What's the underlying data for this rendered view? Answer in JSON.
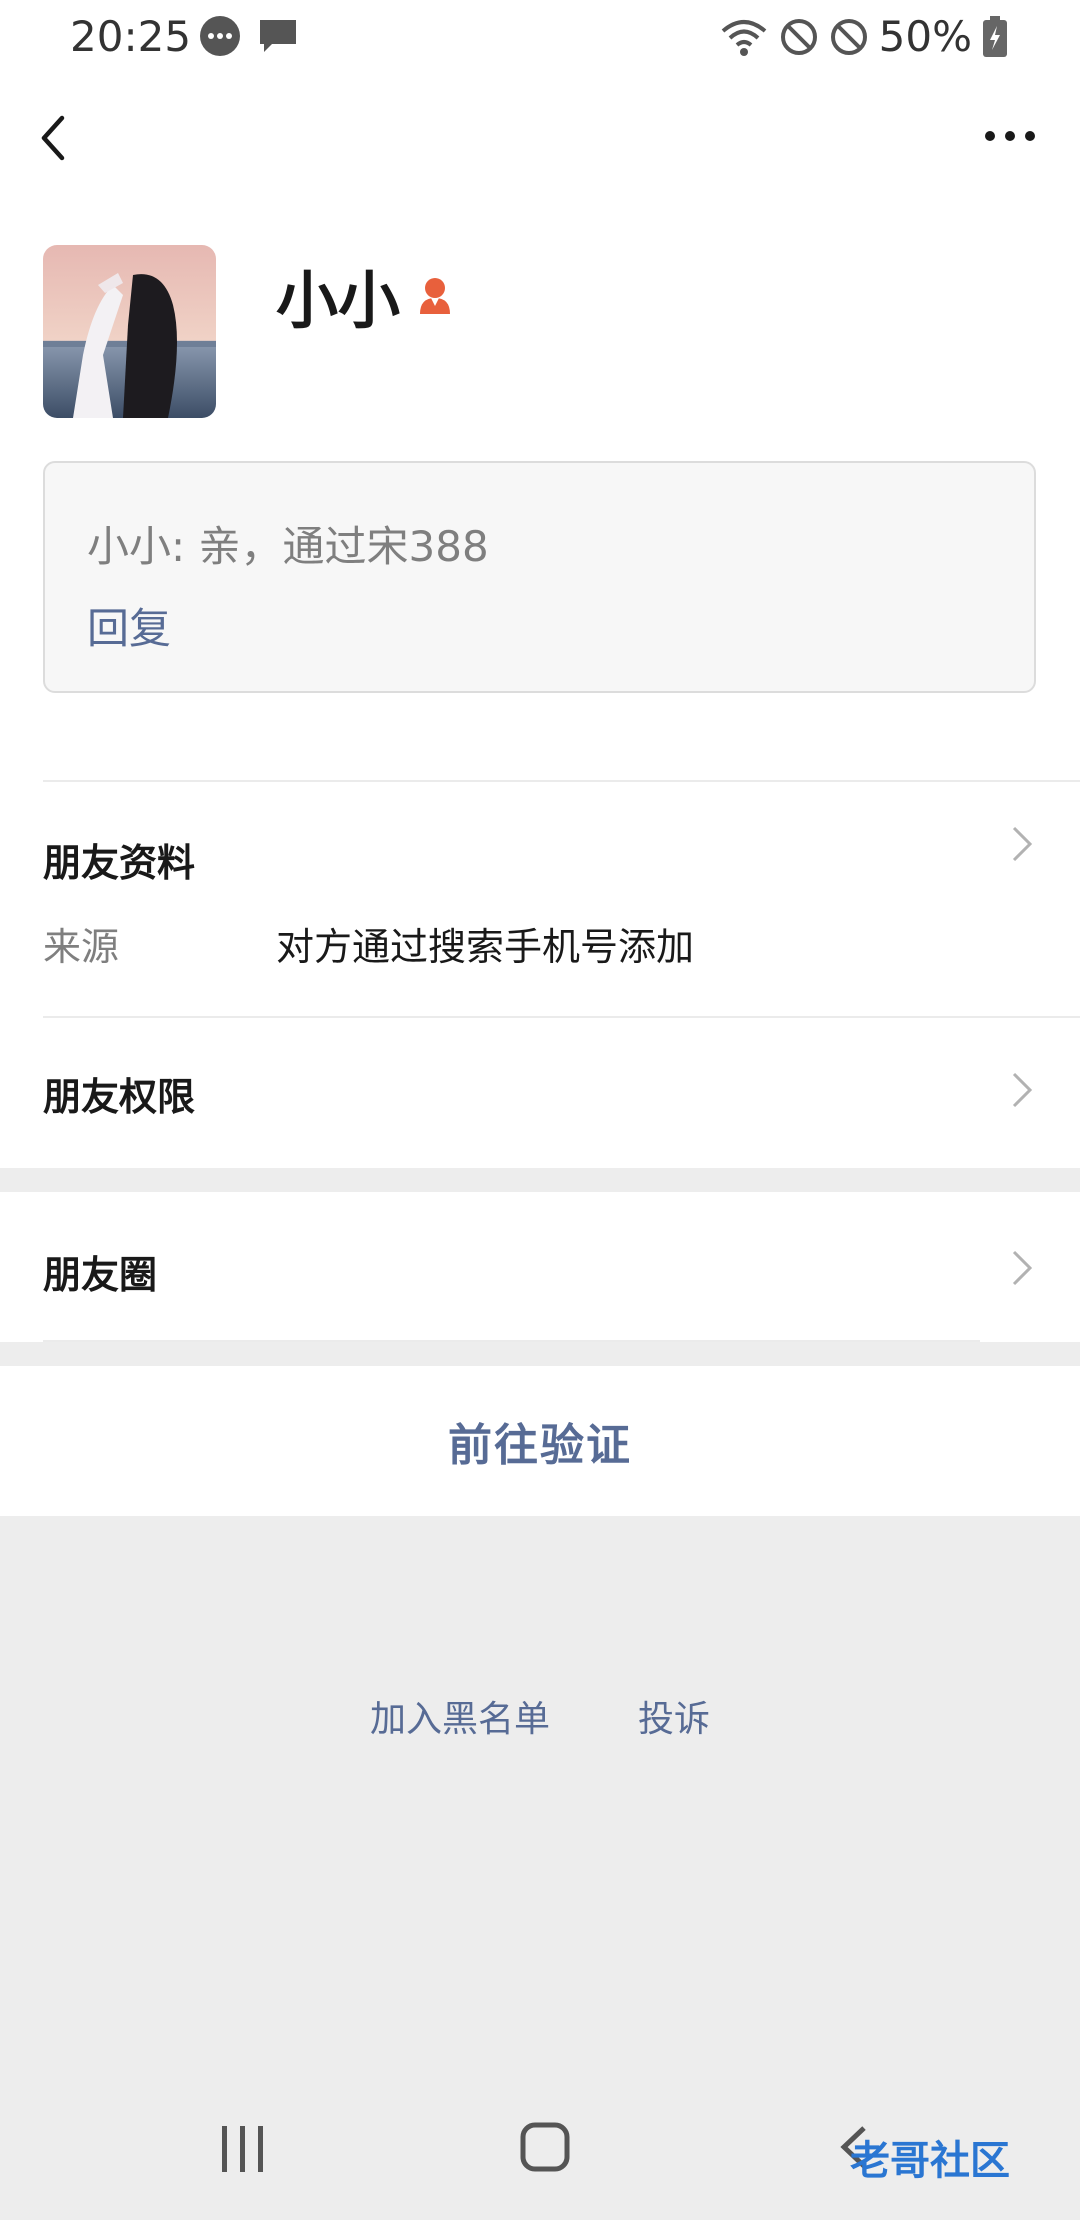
{
  "status_bar": {
    "time": "20:25",
    "battery": "50%"
  },
  "profile": {
    "name": "小小",
    "message": "小小: 亲，通过宋388",
    "reply_label": "回复"
  },
  "friend_info": {
    "title": "朋友资料",
    "source_label": "来源",
    "source_value": "对方通过搜索手机号添加",
    "permissions_label": "朋友权限"
  },
  "moments_label": "朋友圈",
  "verify_button": "前往验证",
  "links": {
    "blacklist": "加入黑名单",
    "report": "投诉"
  },
  "watermark": "老哥社区",
  "colors": {
    "link": "#576b95",
    "background": "#ededed",
    "gender_icon": "#e64340"
  }
}
